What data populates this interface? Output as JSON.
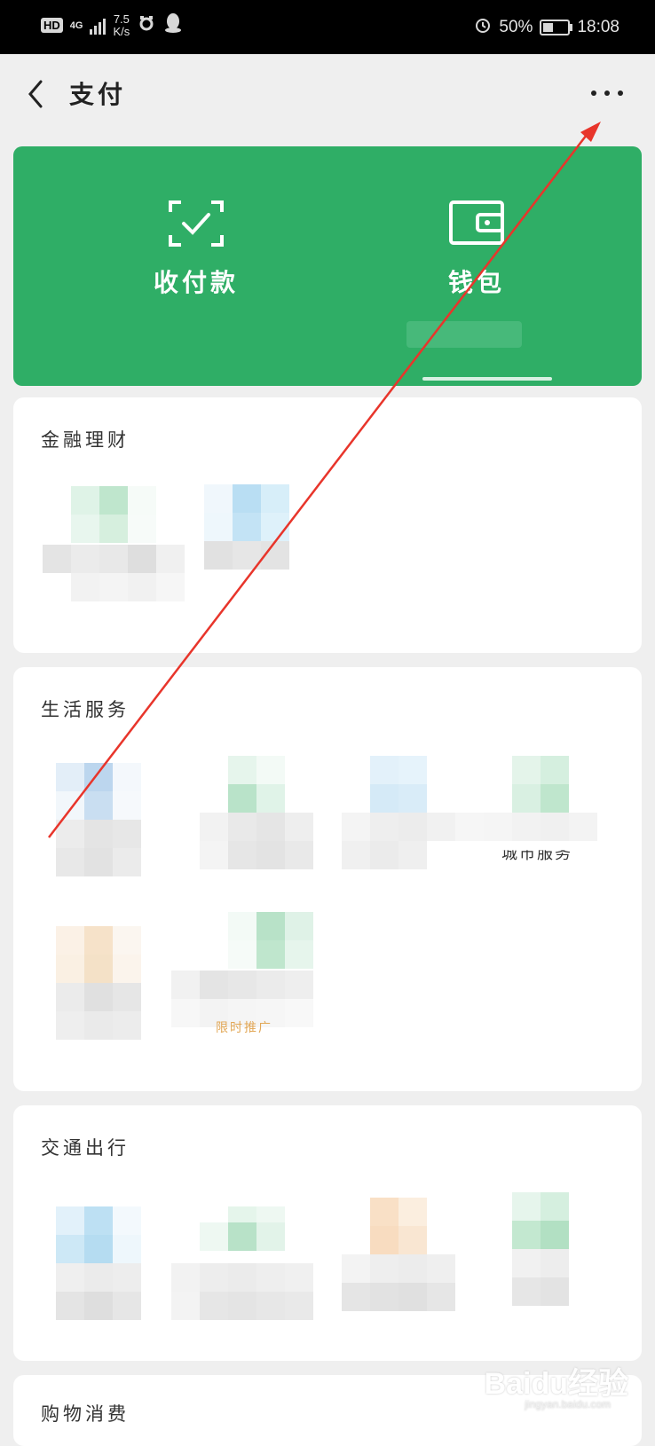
{
  "status_bar": {
    "hd": "HD",
    "network": "4G",
    "speed_value": "7.5",
    "speed_unit": "K/s",
    "battery": "50%",
    "time": "18:08"
  },
  "header": {
    "title": "支付",
    "back_icon": "chevron-left-icon",
    "more_icon": "more-horizontal-icon"
  },
  "wallet_card": {
    "color": "#2fae66",
    "items": [
      {
        "label": "收付款",
        "icon": "scan-check-icon"
      },
      {
        "label": "钱包",
        "icon": "wallet-icon"
      }
    ]
  },
  "sections": [
    {
      "title": "金融理财"
    },
    {
      "title": "生活服务",
      "promo": "限时推广",
      "partial_label": "城市服务"
    },
    {
      "title": "交通出行"
    },
    {
      "title": "购物消费"
    }
  ],
  "watermark": {
    "brand": "Baidu经验",
    "site": "jingyan.baidu.com"
  },
  "annotation_color": "#e8352b"
}
